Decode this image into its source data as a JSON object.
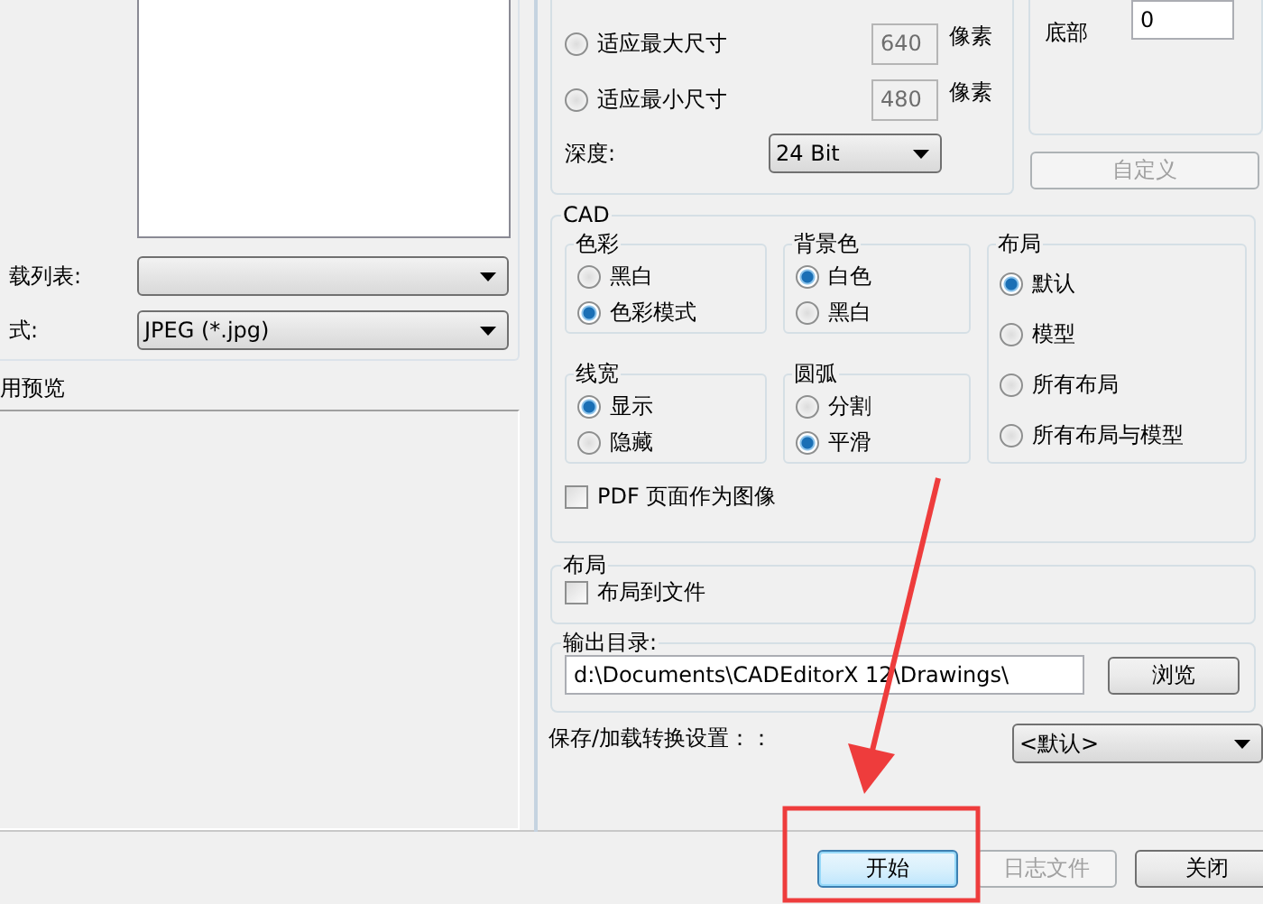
{
  "left_pane": {
    "load_list": {
      "label": "载列表:"
    },
    "format": {
      "label": "式:",
      "value": "JPEG (*.jpg)"
    },
    "preview_group": {
      "title": "用预览"
    }
  },
  "size_group": {
    "options": [
      {
        "label": "适应最大尺寸",
        "selected": false,
        "value": "640",
        "value_disabled": true,
        "unit": "像素"
      },
      {
        "label": "适应最小尺寸",
        "selected": false,
        "value": "480",
        "value_disabled": true,
        "unit": "像素"
      }
    ],
    "depth": {
      "label": "深度:",
      "value": "24 Bit"
    }
  },
  "margins": {
    "bottom": {
      "label": "底部",
      "value": "0"
    },
    "custom_button": {
      "label": "自定义",
      "disabled": true
    }
  },
  "cad": {
    "title": "CAD",
    "groups": [
      {
        "title": "色彩",
        "options": [
          {
            "label": "黑白",
            "selected": false
          },
          {
            "label": "色彩模式",
            "selected": true
          }
        ]
      },
      {
        "title": "线宽",
        "options": [
          {
            "label": "显示",
            "selected": true
          },
          {
            "label": "隐藏",
            "selected": false
          }
        ]
      },
      {
        "title": "背景色",
        "options": [
          {
            "label": "白色",
            "selected": true
          },
          {
            "label": "黑白",
            "selected": false
          }
        ]
      },
      {
        "title": "圆弧",
        "options": [
          {
            "label": "分割",
            "selected": false
          },
          {
            "label": "平滑",
            "selected": true
          }
        ]
      },
      {
        "title": "布局",
        "options": [
          {
            "label": "默认",
            "selected": true
          },
          {
            "label": "模型",
            "selected": false
          },
          {
            "label": "所有布局",
            "selected": false
          },
          {
            "label": "所有布局与模型",
            "selected": false
          }
        ]
      }
    ],
    "pdf_as_image": {
      "label": "PDF 页面作为图像",
      "checked": false
    }
  },
  "layout_group": {
    "title": "布局",
    "layout_to_file": {
      "label": "布局到文件",
      "checked": false
    }
  },
  "output": {
    "title": "输出目录:",
    "path": "d:\\Documents\\CADEditorX 12\\Drawings\\",
    "browse": "浏览"
  },
  "settings": {
    "label": "保存/加载转换设置：：",
    "value": "<默认>"
  },
  "buttons": [
    {
      "label": "开始",
      "focused": true,
      "disabled": false
    },
    {
      "label": "日志文件",
      "focused": false,
      "disabled": true
    },
    {
      "label": "关闭",
      "focused": false,
      "disabled": false
    }
  ]
}
